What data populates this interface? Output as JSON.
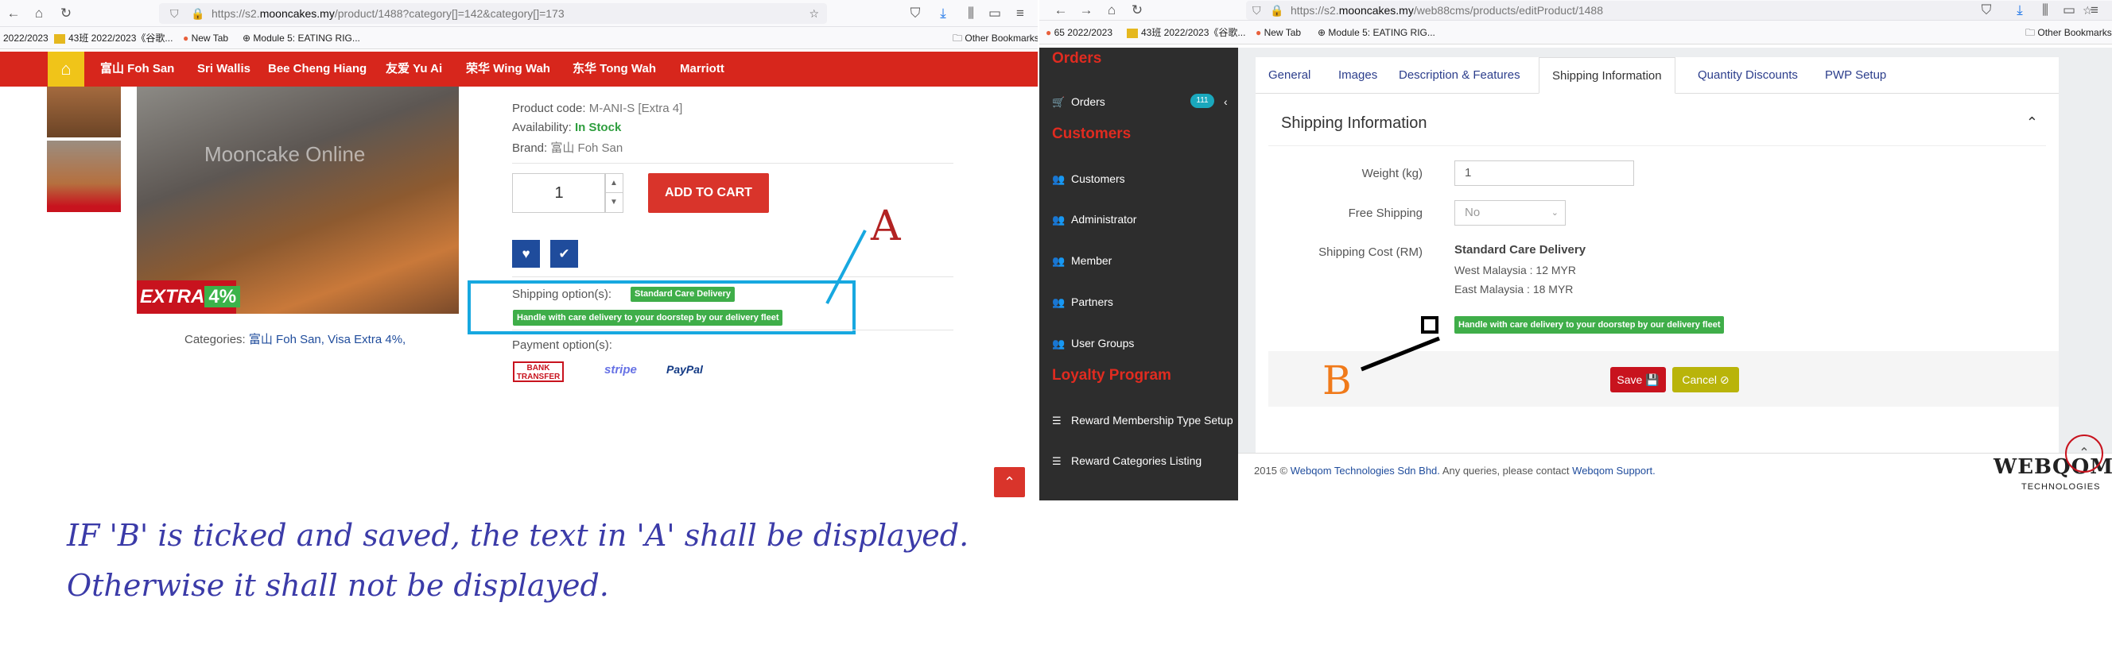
{
  "left_browser": {
    "url_prefix": "https://s2.",
    "url_domain": "mooncakes.my",
    "url_suffix": "/product/1488?category[]=142&category[]=173",
    "bookmarks": [
      "2022/2023",
      "43班 2022/2023《谷歌...",
      "New Tab",
      "Module 5: EATING RIG...",
      "Other Bookmarks"
    ],
    "nav_items": [
      "富山 Foh San",
      "Sri Wallis",
      "Bee Cheng Hiang",
      "友爱 Yu Ai",
      "荣华 Wing Wah",
      "东华 Tong Wah",
      "Marriott"
    ],
    "watermark": "Mooncake Online",
    "extra_badge": "EXTRA",
    "extra_pct": "4%",
    "categories_label": "Categories:",
    "categories_value": "富山 Foh San, Visa Extra 4%,",
    "product_code_label": "Product code:",
    "product_code_value": "M-ANI-S [Extra 4]",
    "availability_label": "Availability:",
    "availability_value": "In Stock",
    "brand_label": "Brand:",
    "brand_value": "富山 Foh San",
    "quantity": "1",
    "add_to_cart": "ADD TO CART",
    "shipping_option_label": "Shipping option(s):",
    "shipping_badge": "Standard Care Delivery",
    "handle_badge": "Handle with care delivery to your doorstep by our delivery fleet",
    "payment_label": "Payment option(s):",
    "payments": [
      "BANK TRANSFER",
      "stripe",
      "PayPal"
    ]
  },
  "right_browser": {
    "url_prefix": "https://s2.",
    "url_domain": "mooncakes.my",
    "url_suffix": "/web88cms/products/editProduct/1488",
    "bookmarks": [
      "65 2022/2023",
      "43班 2022/2023《谷歌...",
      "New Tab",
      "Module 5: EATING RIG...",
      "Other Bookmarks"
    ],
    "sidebar": {
      "orders_header": "Orders",
      "orders_item": "Orders",
      "orders_badge": "111",
      "customers_header": "Customers",
      "customers_items": [
        "Customers",
        "Administrator",
        "Member",
        "Partners",
        "User Groups"
      ],
      "loyalty_header": "Loyalty Program",
      "loyalty_items": [
        "Reward Membership Type Setup",
        "Reward Categories Listing"
      ]
    },
    "tabs": [
      "General",
      "Images",
      "Description & Features",
      "Shipping Information",
      "Quantity Discounts",
      "PWP Setup"
    ],
    "active_tab": "Shipping Information",
    "panel_title": "Shipping Information",
    "weight_label": "Weight (kg)",
    "weight_value": "1",
    "free_shipping_label": "Free Shipping",
    "free_shipping_value": "No",
    "shipping_cost_label": "Shipping Cost (RM)",
    "shipping_cost_title": "Standard Care Delivery",
    "west_malaysia": "West Malaysia : 12 MYR",
    "east_malaysia": "East Malaysia : 18 MYR",
    "handle_badge": "Handle with care delivery to your doorstep by our delivery fleet",
    "handle_checked": false,
    "save": "Save",
    "cancel": "Cancel",
    "footer_prefix": "2015 ©",
    "footer_company": "Webqom Technologies Sdn Bhd.",
    "footer_middle": "Any queries, please contact",
    "footer_support": "Webqom Support.",
    "logo_text": "WEBQOM",
    "logo_sub": "TECHNOLOGIES"
  },
  "annotations": {
    "label_a": "A",
    "label_b": "B",
    "line1": "IF 'B' is ticked and saved, the text in 'A' shall be displayed.",
    "line2": "Otherwise it shall not be displayed."
  },
  "colors": {
    "red": "#d7261c",
    "green": "#3fae49",
    "blue_box": "#17a8e0",
    "annotation_text": "#3b3ba8",
    "annotation_a": "#b22222",
    "annotation_b": "#f07a1a"
  }
}
